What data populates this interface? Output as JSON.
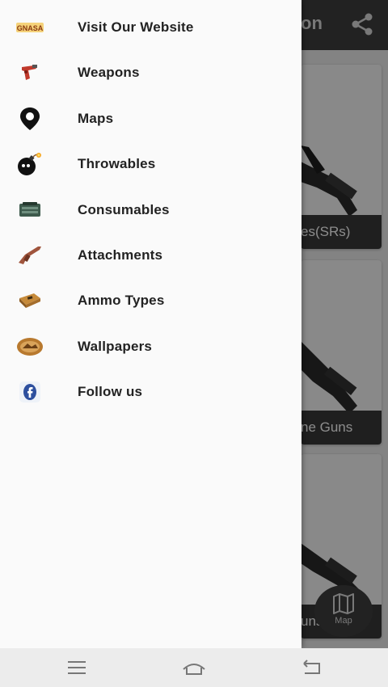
{
  "app": {
    "title": "on",
    "cards": [
      {
        "caption": "es(SRs)"
      },
      {
        "caption": "ne Guns"
      },
      {
        "caption": "uns"
      }
    ],
    "fab_label": "Map"
  },
  "drawer": {
    "items": [
      {
        "label": "Visit Our Website",
        "icon": "website-logo-icon",
        "logo_text": "GNASA"
      },
      {
        "label": "Weapons",
        "icon": "flare-gun-icon"
      },
      {
        "label": "Maps",
        "icon": "map-pin-icon"
      },
      {
        "label": "Throwables",
        "icon": "bomb-icon"
      },
      {
        "label": "Consumables",
        "icon": "med-kit-icon"
      },
      {
        "label": "Attachments",
        "icon": "attachment-icon"
      },
      {
        "label": "Ammo Types",
        "icon": "ammo-box-icon"
      },
      {
        "label": "Wallpapers",
        "icon": "wallpaper-icon"
      },
      {
        "label": "Follow us",
        "icon": "facebook-icon"
      }
    ]
  },
  "navbar": {
    "buttons": [
      "menu",
      "home",
      "back"
    ]
  }
}
